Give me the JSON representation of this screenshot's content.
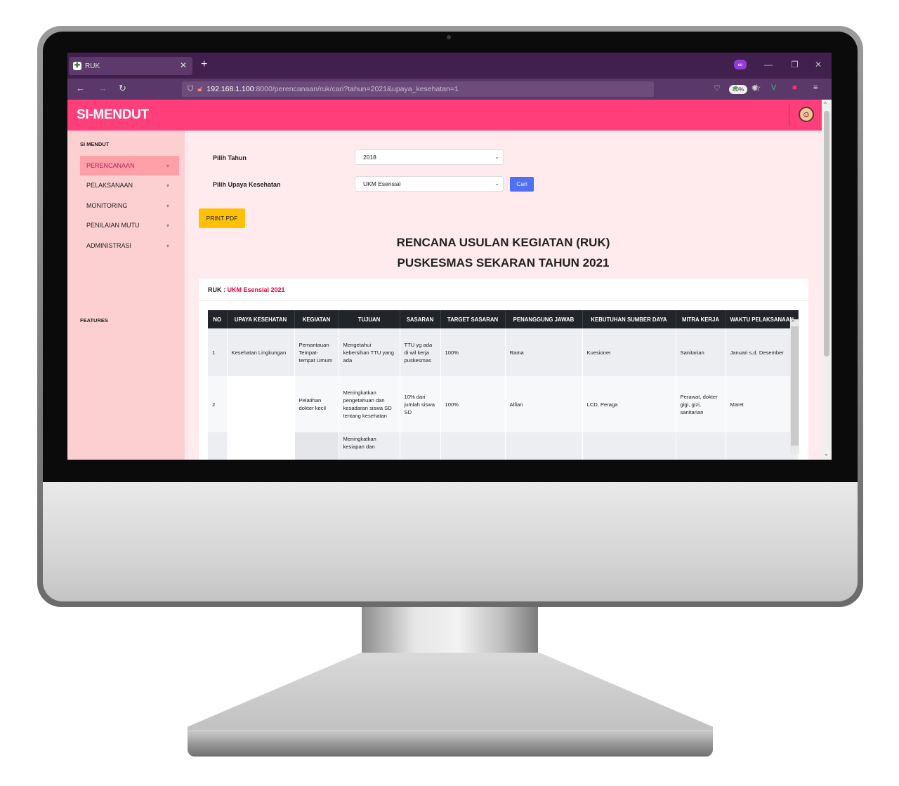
{
  "browser": {
    "tab_title": "RUK",
    "url_host": "192.168.1.100",
    "url_path": ":8000/perencanaan/ruk/cari?tahun=2021&upaya_kesehatan=1",
    "zoom": "80%"
  },
  "app": {
    "title": "SI-MENDUT"
  },
  "sidebar": {
    "section_main": "SI MENDUT",
    "items": [
      {
        "label": "PERENCANAAN",
        "active": true
      },
      {
        "label": "PELAKSANAAN"
      },
      {
        "label": "MONITORING"
      },
      {
        "label": "PENILAIAN MUTU"
      },
      {
        "label": "ADMINISTRASI"
      }
    ],
    "section_features": "FEATURES"
  },
  "form": {
    "tahun_label": "Pilih Tahun",
    "tahun_value": "2018",
    "upaya_label": "Pilih Upaya Kesehatan",
    "upaya_value": "UKM Esensial",
    "cari_label": "Cari",
    "print_label": "PRINT PDF"
  },
  "report": {
    "title_line1": "RENCANA USULAN KEGIATAN (RUK)",
    "title_line2": "PUSKESMAS SEKARAN TAHUN 2021",
    "ruk_prefix": "RUK : ",
    "ruk_value": "UKM Esensial 2021"
  },
  "table": {
    "headers": [
      "NO",
      "UPAYA KESEHATAN",
      "KEGIATAN",
      "TUJUAN",
      "SASARAN",
      "TARGET SASARAN",
      "PENANGGUNG JAWAB",
      "KEBUTUHAN SUMBER DAYA",
      "MITRA KERJA",
      "WAKTU PELAKSANAAN"
    ],
    "rows": [
      {
        "no": "1",
        "upaya": "Kesehatan Lingkungan",
        "kegiatan": "Pemantauan Tempat-tempat Umum",
        "tujuan": "Mengetahui kebersihan TTU yang ada",
        "sasaran": "TTU yg ada di wil kerja puskesmas",
        "target": "100%",
        "pj": "Rama",
        "kebutuhan": "Kuesioner",
        "mitra": "Sanitarian",
        "waktu": "Januari s.d. Desember"
      },
      {
        "no": "2",
        "upaya": "",
        "kegiatan": "Pelatihan dokter kecil",
        "tujuan": "Meningkatkan pengetahuan dan kesadaran siswa SD tentang kesehatan",
        "sasaran": "10% dari jumlah siswa SD",
        "target": "100%",
        "pj": "Alfian",
        "kebutuhan": "LCD, Peraga",
        "mitra": "Perawat, dokter gigi, gizi, sanitarian",
        "waktu": "Maret"
      },
      {
        "no": "",
        "upaya": "",
        "kegiatan": "",
        "tujuan": "Meningkatkan kesiapan dan",
        "sasaran": "",
        "target": "",
        "pj": "",
        "kebutuhan": "",
        "mitra": "",
        "waktu": ""
      }
    ]
  }
}
